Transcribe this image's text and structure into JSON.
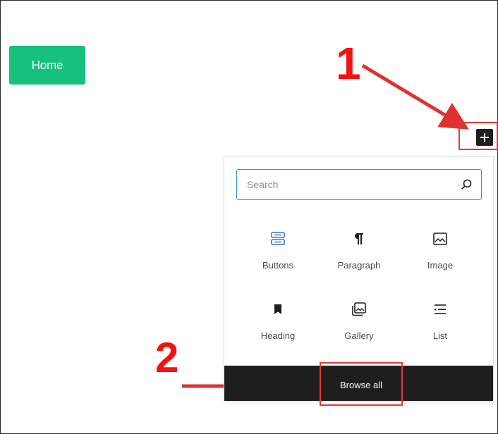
{
  "header": {
    "home_label": "Home"
  },
  "annotations": {
    "step1": "1",
    "step2": "2"
  },
  "inserter": {
    "search": {
      "placeholder": "Search",
      "value": ""
    },
    "blocks": [
      {
        "label": "Buttons",
        "icon": "buttons-icon",
        "color": "#3576c9"
      },
      {
        "label": "Paragraph",
        "icon": "paragraph-icon",
        "color": "#1e1e1e"
      },
      {
        "label": "Image",
        "icon": "image-icon",
        "color": "#1e1e1e"
      },
      {
        "label": "Heading",
        "icon": "heading-icon",
        "color": "#1e1e1e"
      },
      {
        "label": "Gallery",
        "icon": "gallery-icon",
        "color": "#1e1e1e"
      },
      {
        "label": "List",
        "icon": "list-icon",
        "color": "#1e1e1e"
      }
    ],
    "browse_all_label": "Browse all"
  },
  "colors": {
    "accent": "#16c17f",
    "highlight": "#e53935",
    "focus": "#3d8fd1"
  }
}
